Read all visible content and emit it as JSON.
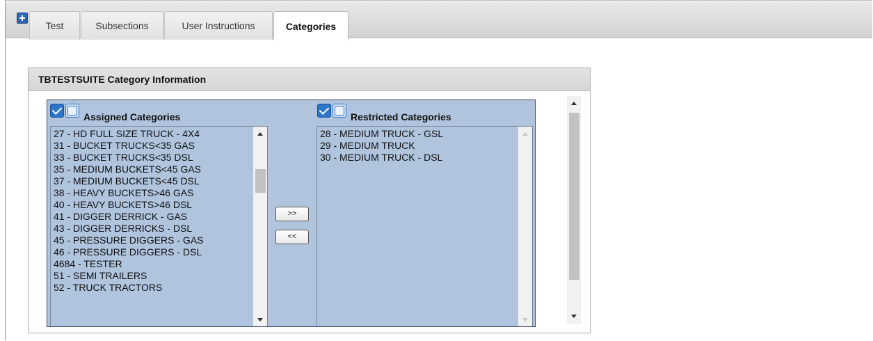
{
  "tabs": [
    {
      "label": "Test"
    },
    {
      "label": "Subsections"
    },
    {
      "label": "User Instructions"
    },
    {
      "label": "Categories",
      "active": true
    }
  ],
  "panel": {
    "title": "TBTESTSUITE Category Information"
  },
  "assigned": {
    "title": "Assigned Categories",
    "items": [
      "27 - HD FULL SIZE TRUCK - 4X4",
      "31 - BUCKET TRUCKS<35 GAS",
      "33 - BUCKET TRUCKS<35 DSL",
      "35 - MEDIUM BUCKETS<45 GAS",
      "37 - MEDIUM BUCKETS<45 DSL",
      "38 - HEAVY BUCKETS>46 GAS",
      "40 - HEAVY BUCKETS>46 DSL",
      "41 - DIGGER DERRICK - GAS",
      "43 - DIGGER DERRICKS - DSL",
      "45 - PRESSURE DIGGERS - GAS",
      "46 - PRESSURE DIGGERS - DSL",
      "4684 - TESTER",
      "51 - SEMI TRAILERS",
      "52 - TRUCK TRACTORS"
    ]
  },
  "restricted": {
    "title": "Restricted Categories",
    "items": [
      "28 - MEDIUM TRUCK - GSL",
      "29 - MEDIUM TRUCK",
      "30 - MEDIUM TRUCK - DSL"
    ]
  },
  "buttons": {
    "move_right": ">>",
    "move_left": "<<"
  },
  "icons": {
    "add_tab": "plus-icon",
    "select_all": "checked-checkbox-icon",
    "select_none": "unchecked-checkbox-icon"
  },
  "colors": {
    "list_background": "#b0c4de",
    "checkbox_blue": "#2e74c8",
    "add_icon_blue": "#2f66b3"
  }
}
